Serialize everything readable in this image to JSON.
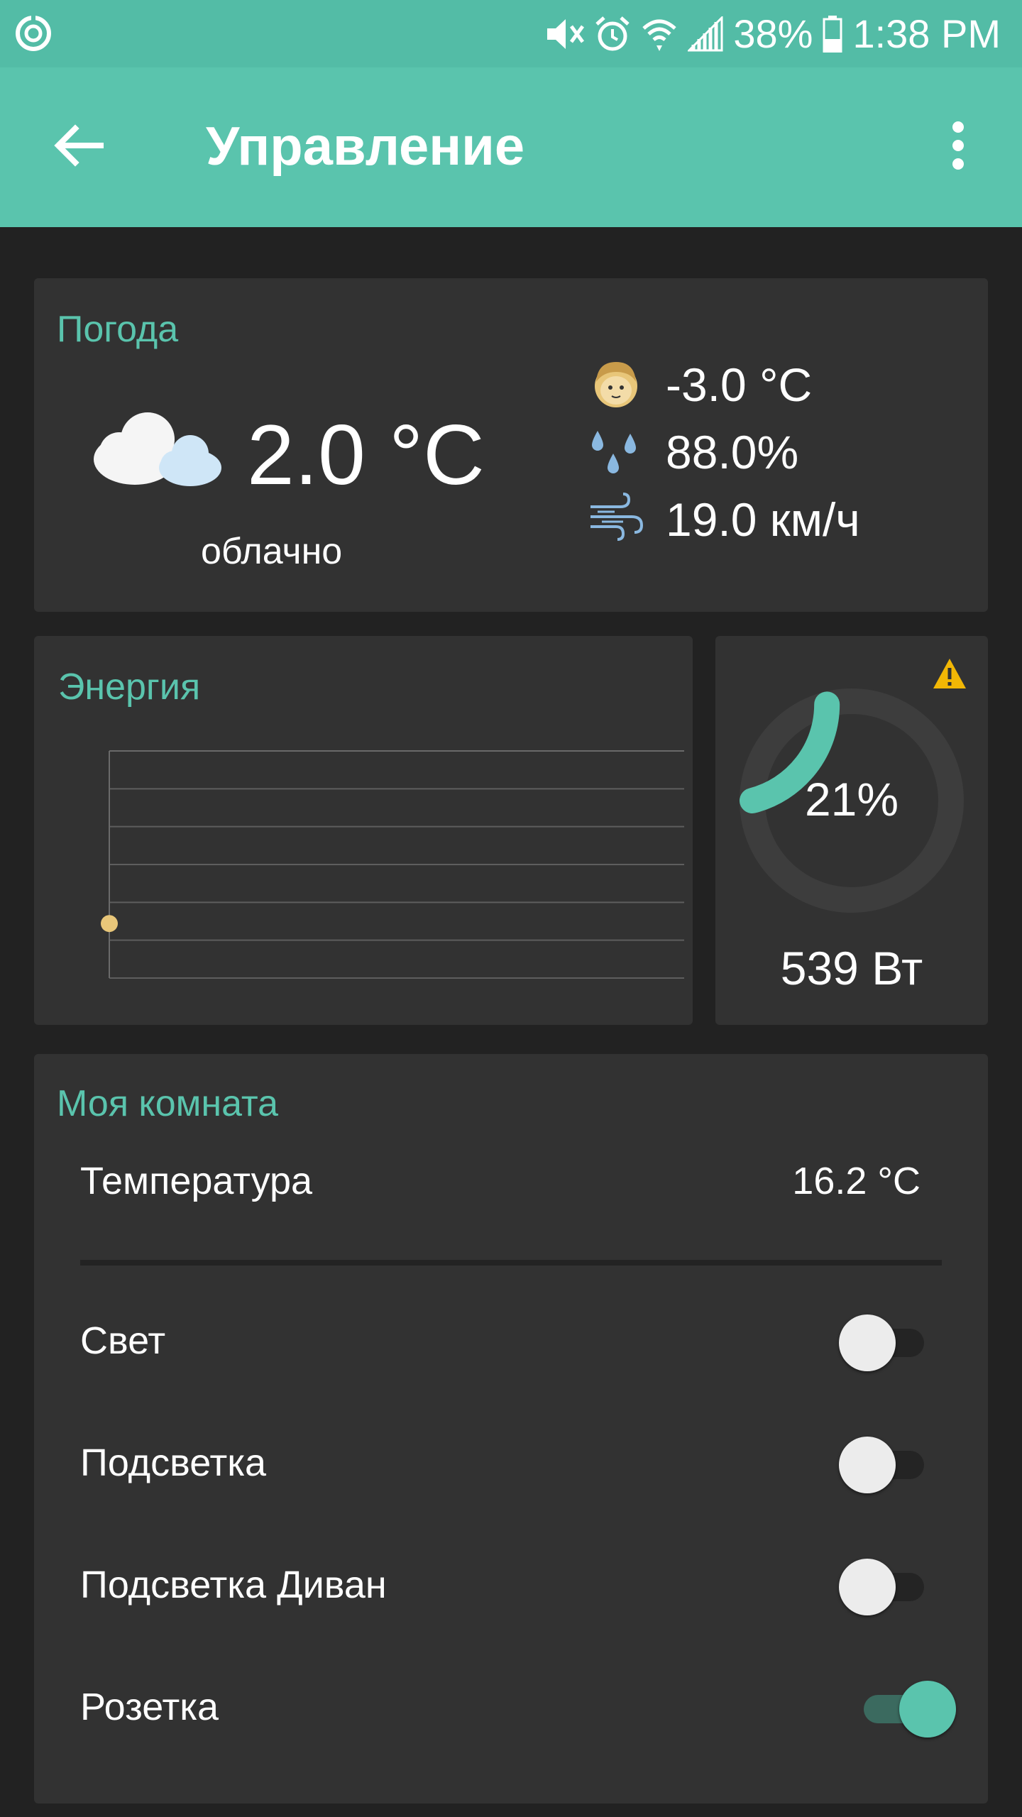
{
  "status_bar": {
    "battery": "38%",
    "time": "1:38 PM"
  },
  "app_bar": {
    "title": "Управление"
  },
  "weather": {
    "title": "Погода",
    "temperature": "2.0 °C",
    "condition": "облачно",
    "feels_like": "-3.0 °C",
    "humidity": "88.0%",
    "wind": "19.0 км/ч"
  },
  "energy": {
    "title": "Энергия",
    "chart_data": {
      "type": "line",
      "title": "",
      "xlabel": "",
      "ylabel": "",
      "grid": true,
      "x": [
        0
      ],
      "y": [
        539
      ],
      "point_color": "#e8c679"
    }
  },
  "gauge": {
    "percent_label": "21%",
    "percent": 21,
    "watts": "539 Вт",
    "fill_color": "#5ac4ad"
  },
  "room": {
    "title": "Моя комната",
    "temperature_label": "Температура",
    "temperature_value": "16.2 °C",
    "switches": [
      {
        "label": "Свет",
        "on": false
      },
      {
        "label": "Подсветка",
        "on": false
      },
      {
        "label": "Подсветка Диван",
        "on": false
      },
      {
        "label": "Розетка",
        "on": true
      }
    ]
  },
  "colors": {
    "accent": "#5ac4ad",
    "status_bar": "#53bca6",
    "card": "#323232",
    "background": "#222222"
  }
}
